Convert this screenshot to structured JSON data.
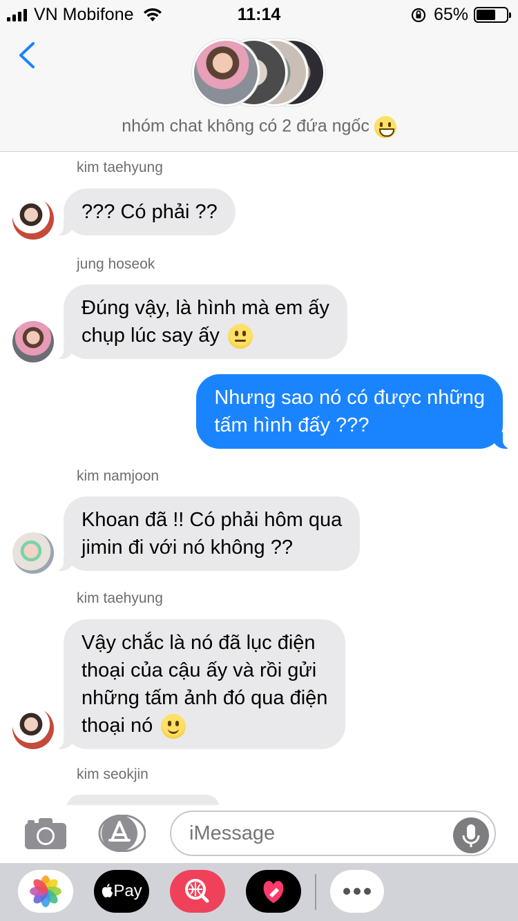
{
  "status_bar": {
    "carrier": "VN Mobifone",
    "time": "11:14",
    "battery_percent": "65%",
    "battery_level": 0.65
  },
  "header": {
    "group_name": "nhóm chat không có 2 đứa ngốc"
  },
  "messages": [
    {
      "sender": "kim taehyung",
      "direction": "incoming",
      "text": "??? Có phải ??"
    },
    {
      "sender": "jung hoseok",
      "direction": "incoming",
      "text_line1": "Đúng vậy, là hình mà em ấy",
      "text_line2": "chụp lúc say ấy"
    },
    {
      "sender": "",
      "direction": "outgoing",
      "text_line1": "Nhưng sao nó có được những",
      "text_line2": "tấm hình đấy ???"
    },
    {
      "sender": "kim namjoon",
      "direction": "incoming",
      "text_line1": "Khoan đã !! Có phải hôm qua",
      "text_line2": "jimin đi với nó không ??"
    },
    {
      "sender": "kim taehyung",
      "direction": "incoming",
      "text_line1": "Vậy chắc là nó đã lục điện",
      "text_line2": "thoại của cậu ấy và rồi gửi",
      "text_line3": "những tấm ảnh đó qua điện",
      "text_line4": "thoại nó"
    },
    {
      "sender": "kim seokjin",
      "direction": "incoming",
      "text": ""
    }
  ],
  "compose": {
    "placeholder": "iMessage"
  },
  "app_drawer": {
    "pay_label": "Pay",
    "icons": [
      "photos-icon",
      "apple-pay-icon",
      "search-images-icon",
      "digital-touch-icon",
      "more-icon"
    ]
  },
  "colors": {
    "outgoing_bubble": "#1a84ff",
    "incoming_bubble": "#e9e9eb",
    "back_chevron": "#1a84ff"
  }
}
